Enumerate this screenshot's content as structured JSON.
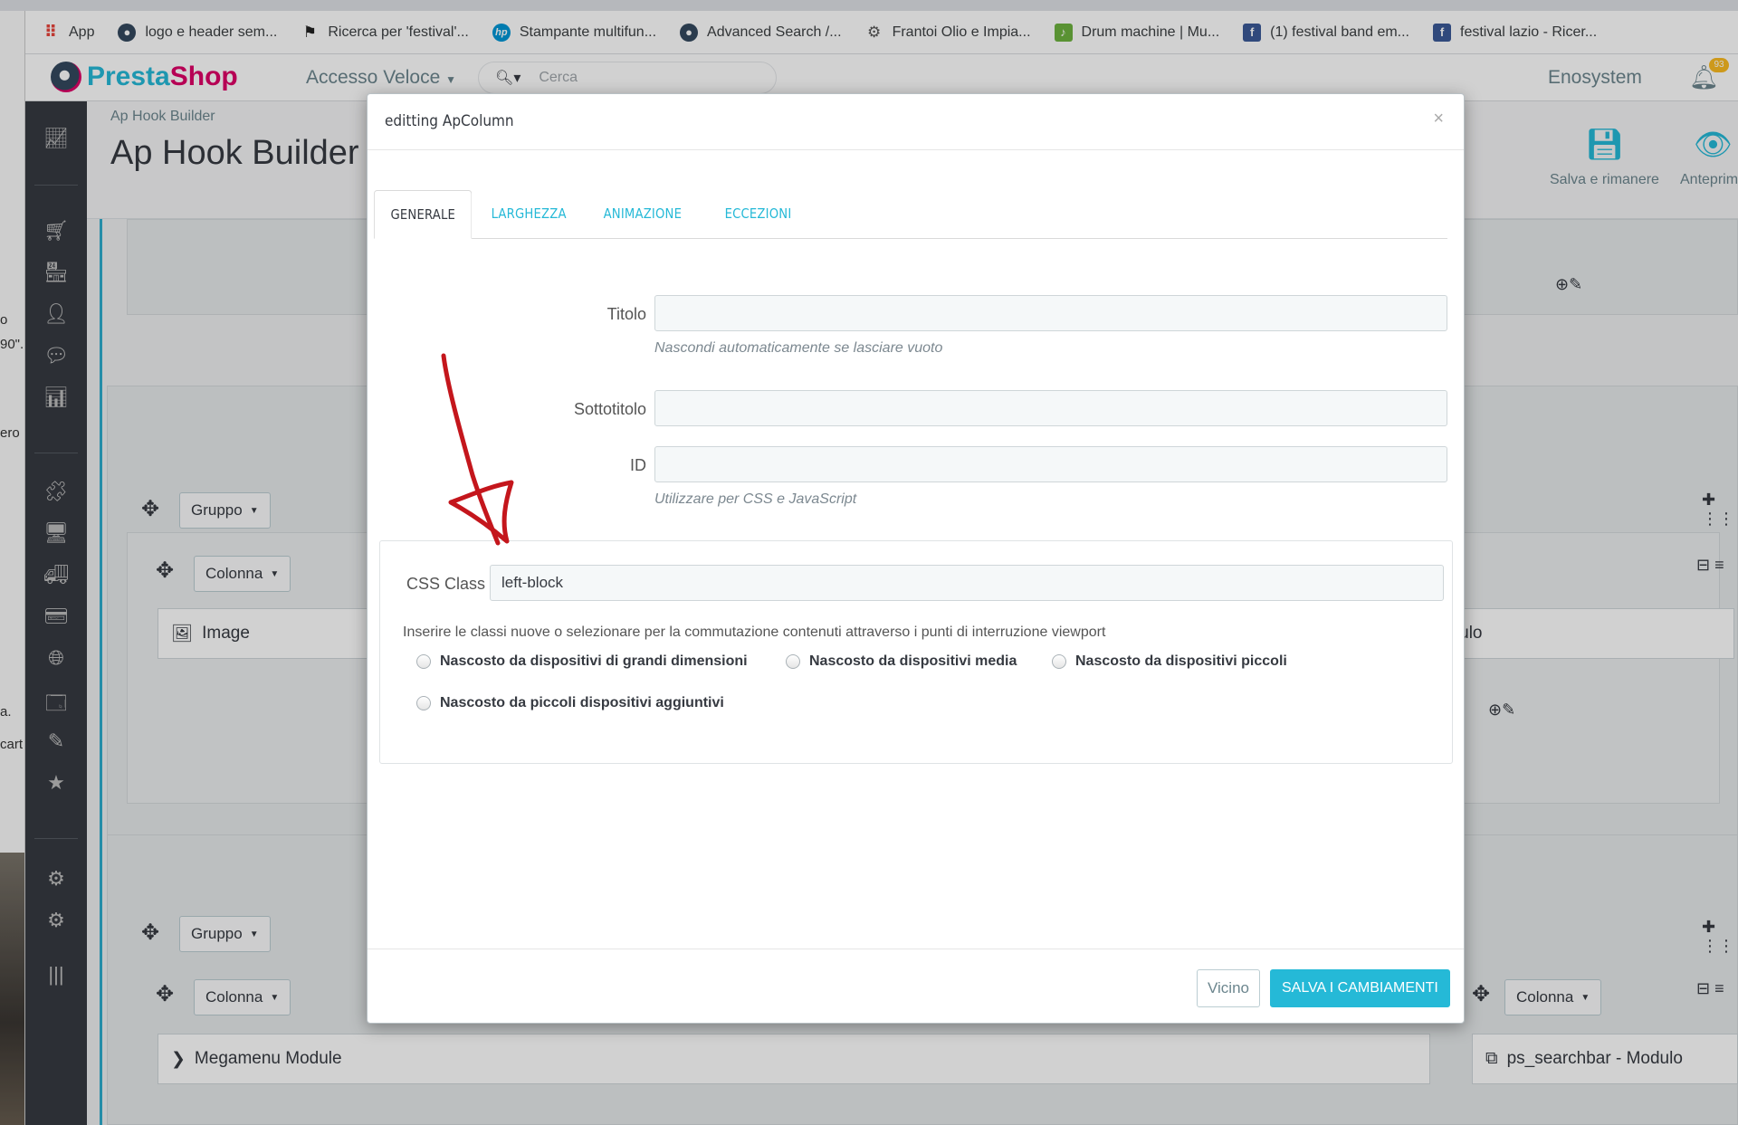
{
  "bookmarks": [
    {
      "label": "App",
      "icon": "apps-grid-icon"
    },
    {
      "label": "logo e header sem...",
      "icon": "prestashop-icon"
    },
    {
      "label": "Ricerca per 'festival'...",
      "icon": "runner-icon"
    },
    {
      "label": "Stampante multifun...",
      "icon": "hp-icon"
    },
    {
      "label": "Advanced Search /...",
      "icon": "prestashop-icon"
    },
    {
      "label": "Frantoi Olio e Impia...",
      "icon": "gear-site-icon"
    },
    {
      "label": "Drum machine | Mu...",
      "icon": "music-icon"
    },
    {
      "label": "(1) festival band em...",
      "icon": "facebook-icon"
    },
    {
      "label": "festival lazio - Ricer...",
      "icon": "facebook-icon"
    }
  ],
  "left_edge": [
    "o",
    "90\"...",
    "ero",
    "a.",
    "cart"
  ],
  "header": {
    "brand_a": "Presta",
    "brand_b": "Shop",
    "quick_access": "Accesso Veloce",
    "search_placeholder": "Cerca",
    "shop_name": "Enosystem",
    "notifications": "93"
  },
  "toolbar": {
    "breadcrumb": "Ap Hook Builder",
    "title": "Ap Hook Builder",
    "save_stay": "Salva e rimanere",
    "preview": "Anteprima"
  },
  "builder": {
    "group_label": "Gruppo",
    "column_label": "Colonna",
    "image_widget": "Image",
    "module_fragment": "odulo",
    "megamenu": "Megamenu Module",
    "searchbar": "ps_searchbar - Modulo"
  },
  "modal": {
    "title": "editting ApColumn",
    "close_symbol": "×",
    "tabs": [
      "GENERALE",
      "LARGHEZZA",
      "ANIMAZIONE",
      "ECCEZIONI"
    ],
    "active_tab": "GENERALE",
    "fields": {
      "title_label": "Titolo",
      "title_value": "",
      "title_help": "Nascondi automaticamente se lasciare vuoto",
      "subtitle_label": "Sottotitolo",
      "subtitle_value": "",
      "id_label": "ID",
      "id_value": "",
      "id_help": "Utilizzare per CSS e JavaScript",
      "css_label": "CSS Class",
      "css_value": "left-block",
      "css_help": "Inserire le classi nuove o selezionare per la commutazione contenuti attraverso i punti di interruzione viewport"
    },
    "hide_options": [
      "Nascosto da dispositivi di grandi dimensioni",
      "Nascosto da dispositivi media",
      "Nascosto da dispositivi piccoli",
      "Nascosto da piccoli dispositivi aggiuntivi"
    ],
    "btn_close": "Vicino",
    "btn_save": "SALVA I CAMBIAMENTI"
  },
  "colors": {
    "accent": "#25b9d7",
    "brand_pink": "#df0067",
    "sidebar": "#363a41",
    "annotation_arrow": "#c4161c"
  }
}
